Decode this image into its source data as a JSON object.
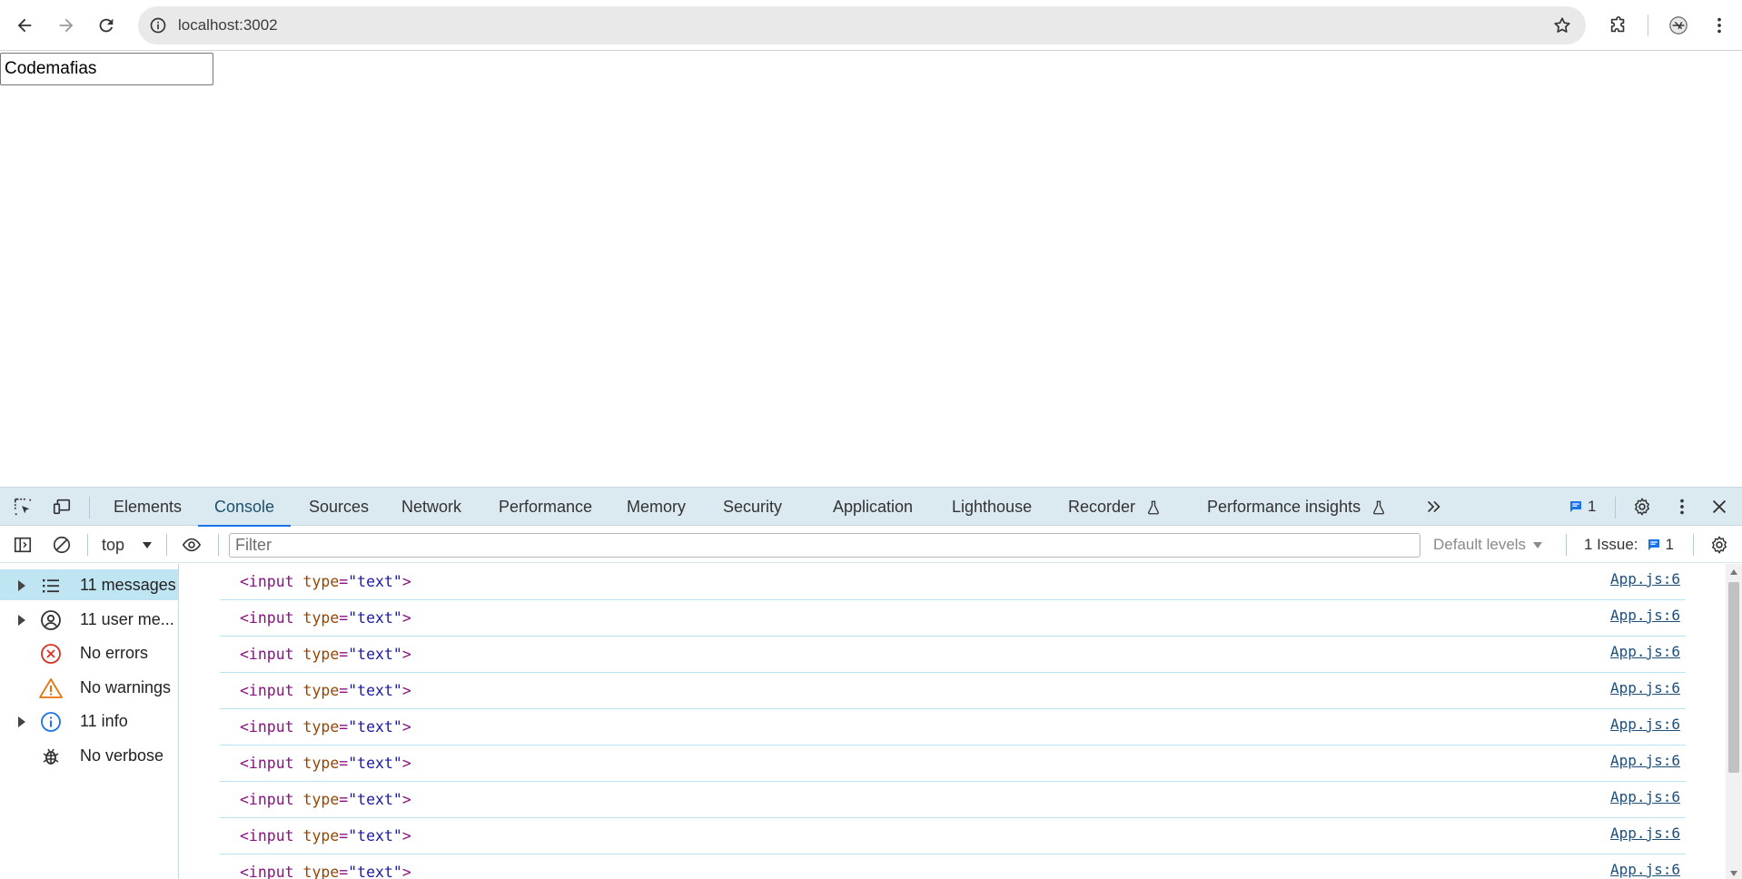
{
  "browser": {
    "url": "localhost:3002"
  },
  "page": {
    "input_value": "Codemafias"
  },
  "devtools": {
    "tabs": [
      {
        "label": "Elements"
      },
      {
        "label": "Console"
      },
      {
        "label": "Sources"
      },
      {
        "label": "Network"
      },
      {
        "label": "Performance"
      },
      {
        "label": "Memory"
      },
      {
        "label": "Security"
      },
      {
        "label": "Application"
      },
      {
        "label": "Lighthouse"
      },
      {
        "label": "Recorder"
      },
      {
        "label": "Performance insights"
      }
    ],
    "active_tab": "Console",
    "issues_badge_count": "1",
    "console_bar": {
      "context": "top",
      "filter_placeholder": "Filter",
      "levels": "Default levels",
      "issues_label": "1 Issue:",
      "issues_count": "1"
    },
    "sidebar": [
      {
        "label": "11 messages",
        "icon": "list-icon",
        "expandable": true,
        "selected": true
      },
      {
        "label": "11 user me...",
        "icon": "user-icon",
        "expandable": true,
        "selected": false
      },
      {
        "label": "No errors",
        "icon": "error-icon",
        "expandable": false,
        "selected": false
      },
      {
        "label": "No warnings",
        "icon": "warning-icon",
        "expandable": false,
        "selected": false
      },
      {
        "label": "11 info",
        "icon": "info-icon",
        "expandable": true,
        "selected": false
      },
      {
        "label": "No verbose",
        "icon": "bug-icon",
        "expandable": false,
        "selected": false
      }
    ],
    "messages": [
      {
        "tag_open": "<input",
        "attr": "type",
        "eq": "=",
        "value": "\"text\"",
        "tag_close": ">",
        "source": "App.js:6"
      },
      {
        "tag_open": "<input",
        "attr": "type",
        "eq": "=",
        "value": "\"text\"",
        "tag_close": ">",
        "source": "App.js:6"
      },
      {
        "tag_open": "<input",
        "attr": "type",
        "eq": "=",
        "value": "\"text\"",
        "tag_close": ">",
        "source": "App.js:6"
      },
      {
        "tag_open": "<input",
        "attr": "type",
        "eq": "=",
        "value": "\"text\"",
        "tag_close": ">",
        "source": "App.js:6"
      },
      {
        "tag_open": "<input",
        "attr": "type",
        "eq": "=",
        "value": "\"text\"",
        "tag_close": ">",
        "source": "App.js:6"
      },
      {
        "tag_open": "<input",
        "attr": "type",
        "eq": "=",
        "value": "\"text\"",
        "tag_close": ">",
        "source": "App.js:6"
      },
      {
        "tag_open": "<input",
        "attr": "type",
        "eq": "=",
        "value": "\"text\"",
        "tag_close": ">",
        "source": "App.js:6"
      },
      {
        "tag_open": "<input",
        "attr": "type",
        "eq": "=",
        "value": "\"text\"",
        "tag_close": ">",
        "source": "App.js:6"
      },
      {
        "tag_open": "<input",
        "attr": "type",
        "eq": "=",
        "value": "\"text\"",
        "tag_close": ">",
        "source": "App.js:6"
      }
    ]
  }
}
